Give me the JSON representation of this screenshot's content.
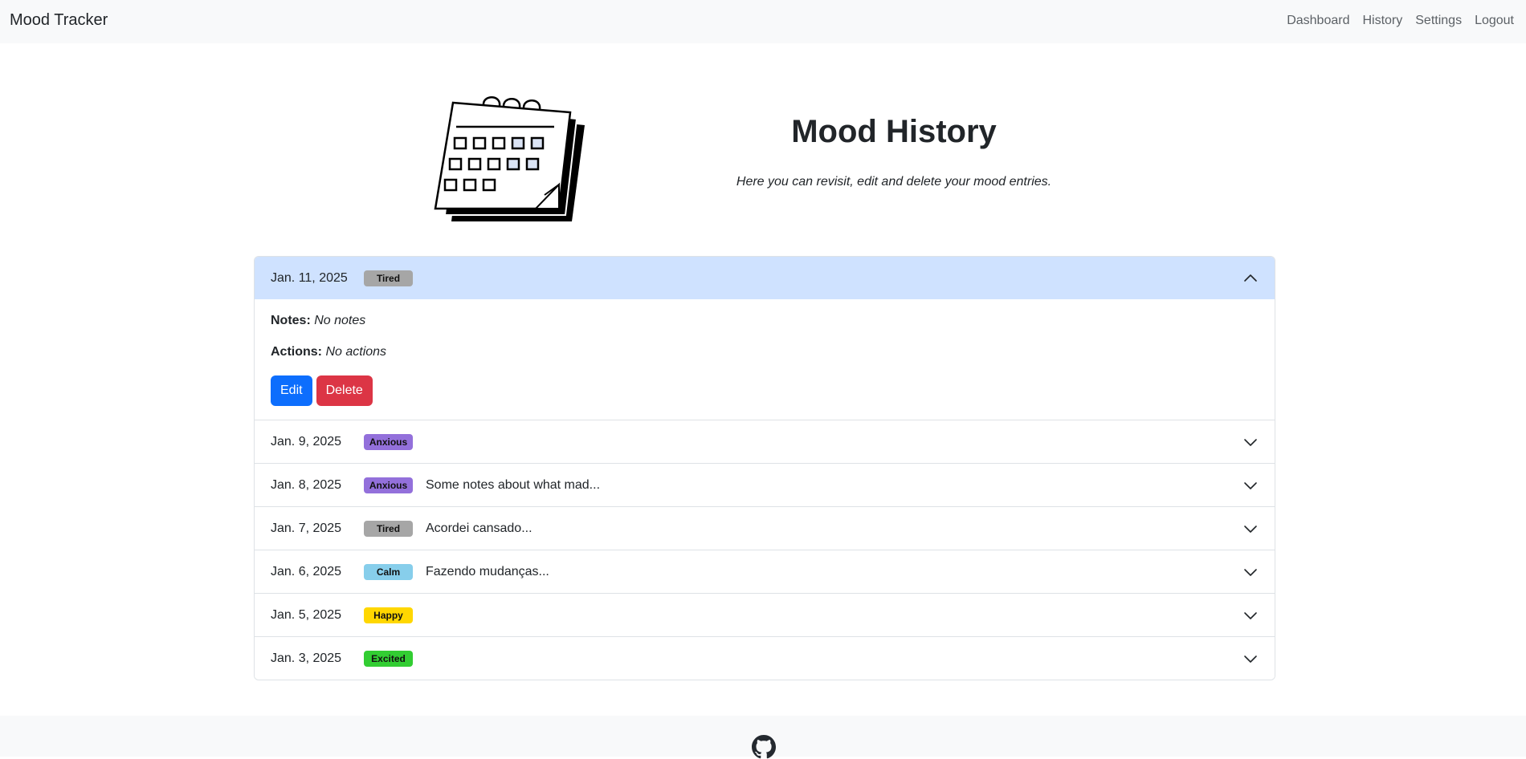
{
  "navbar": {
    "brand": "Mood Tracker",
    "links": [
      "Dashboard",
      "History",
      "Settings",
      "Logout"
    ]
  },
  "header": {
    "title": "Mood History",
    "subtitle": "Here you can revisit, edit and delete your mood entries.",
    "illustration": "calendar-icon"
  },
  "entries": [
    {
      "date": "Jan. 11, 2025",
      "mood": "Tired",
      "mood_color": "#a6a6a6",
      "note": "",
      "expanded": true,
      "notes_label": "Notes:",
      "notes_value": "No notes",
      "actions_label": "Actions:",
      "actions_value": "No actions",
      "edit_label": "Edit",
      "delete_label": "Delete"
    },
    {
      "date": "Jan. 9, 2025",
      "mood": "Anxious",
      "mood_color": "#9370db",
      "note": ""
    },
    {
      "date": "Jan. 8, 2025",
      "mood": "Anxious",
      "mood_color": "#9370db",
      "note": "Some notes about what mad..."
    },
    {
      "date": "Jan. 7, 2025",
      "mood": "Tired",
      "mood_color": "#a6a6a6",
      "note": "Acordei cansado..."
    },
    {
      "date": "Jan. 6, 2025",
      "mood": "Calm",
      "mood_color": "#87ceeb",
      "note": "Fazendo mudanças..."
    },
    {
      "date": "Jan. 5, 2025",
      "mood": "Happy",
      "mood_color": "#ffd700",
      "note": ""
    },
    {
      "date": "Jan. 3, 2025",
      "mood": "Excited",
      "mood_color": "#32cd32",
      "note": ""
    }
  ],
  "footer": {
    "icon": "github-icon"
  }
}
